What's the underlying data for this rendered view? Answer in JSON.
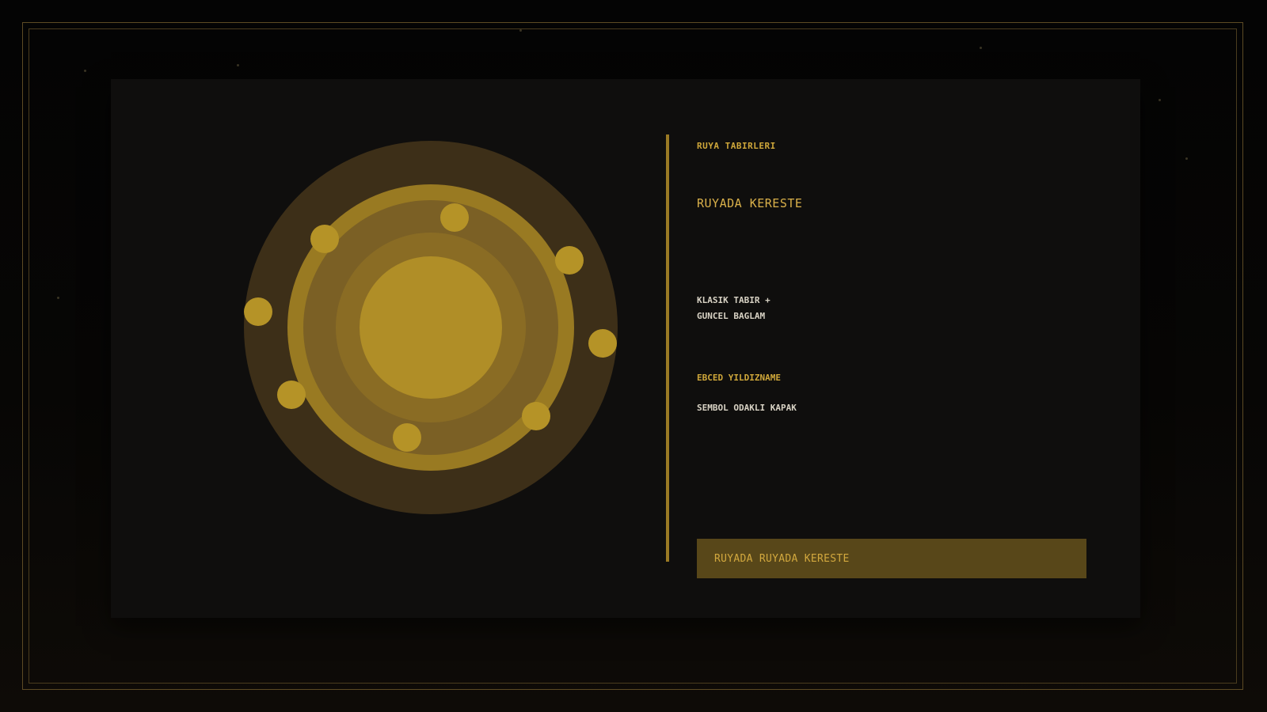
{
  "header": {
    "kicker": "RUYA TABIRLERI",
    "title": "RUYADA KERESTE"
  },
  "description": {
    "line1": "KLASIK TABIR +",
    "line2": "GUNCEL BAGLAM"
  },
  "section": {
    "kicker": "EBCED YILDIZNAME",
    "tagline": "SEMBOL ODAKLI KAPAK"
  },
  "cta": {
    "label": "RUYADA RUYADA KERESTE"
  },
  "colors": {
    "accent": "#d9b04a",
    "accent_dark": "#584719",
    "panel": "#0f0e0d",
    "frame": "#5c4a24"
  },
  "emblem": {
    "icon": "sun-emblem-icon",
    "orbit_count": 8
  }
}
